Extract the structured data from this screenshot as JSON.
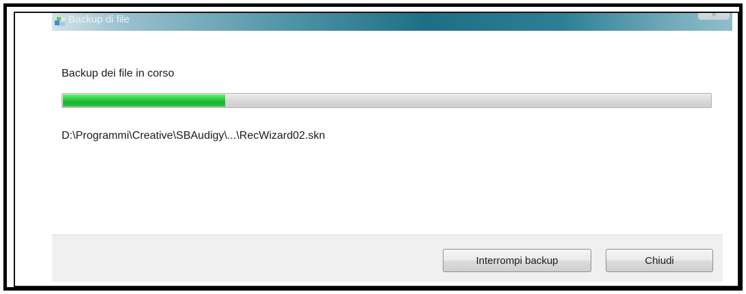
{
  "window": {
    "title": "Backup di file",
    "close_glyph": "✕"
  },
  "main": {
    "heading": "Backup dei file in corso",
    "progress_fraction": 0.25,
    "current_file": "D:\\Programmi\\Creative\\SBAudigy\\...\\RecWizard02.skn"
  },
  "footer": {
    "stop_button_label": "Interrompi backup",
    "close_button_label": "Chiudi"
  },
  "icons": {
    "app_icon": "backup-icon",
    "close_icon": "close-icon"
  },
  "colors": {
    "progress_green": "#22c23a",
    "titlebar_teal": "#1d6f86"
  }
}
